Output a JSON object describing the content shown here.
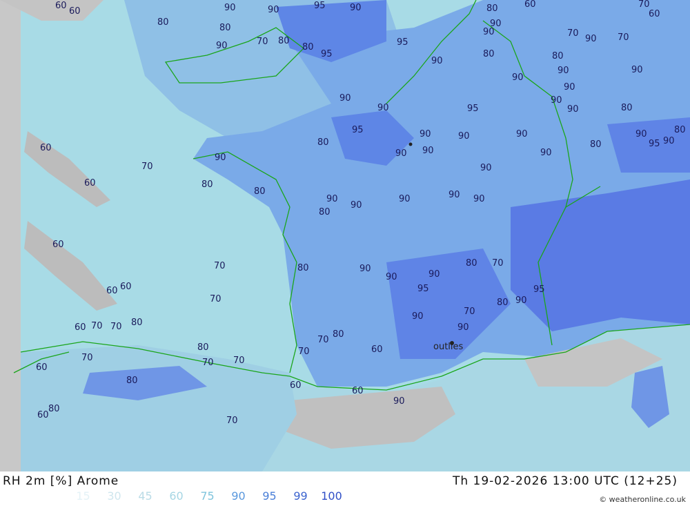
{
  "map": {
    "colors": {
      "land_low": "#9fd3e0",
      "land_mid": "#8fbfe6",
      "land_high": "#6f9ee8",
      "land_max": "#5a7fe6",
      "sea": "#c8c8c8",
      "border": "#1aa51a",
      "contour": "#555577"
    },
    "city_labels": [
      "outlies"
    ],
    "contour_labels": [
      {
        "t": "60"
      },
      {
        "t": "60"
      },
      {
        "t": "90"
      },
      {
        "t": "90"
      },
      {
        "t": "95"
      },
      {
        "t": "90"
      },
      {
        "t": "80"
      },
      {
        "t": "60"
      },
      {
        "t": "70"
      },
      {
        "t": "60"
      },
      {
        "t": "80"
      },
      {
        "t": "80"
      },
      {
        "t": "90"
      },
      {
        "t": "70"
      },
      {
        "t": "80"
      },
      {
        "t": "80"
      },
      {
        "t": "95"
      },
      {
        "t": "95"
      },
      {
        "t": "90"
      },
      {
        "t": "90"
      },
      {
        "t": "90"
      },
      {
        "t": "70"
      },
      {
        "t": "90"
      },
      {
        "t": "70"
      },
      {
        "t": "80"
      },
      {
        "t": "80"
      },
      {
        "t": "90"
      },
      {
        "t": "90"
      },
      {
        "t": "90"
      },
      {
        "t": "90"
      },
      {
        "t": "90"
      },
      {
        "t": "90"
      },
      {
        "t": "95"
      },
      {
        "t": "95"
      },
      {
        "t": "90"
      },
      {
        "t": "90"
      },
      {
        "t": "80"
      },
      {
        "t": "90"
      },
      {
        "t": "95"
      },
      {
        "t": "90"
      },
      {
        "t": "90"
      },
      {
        "t": "90"
      },
      {
        "t": "90"
      },
      {
        "t": "80"
      },
      {
        "t": "90"
      },
      {
        "t": "90"
      },
      {
        "t": "60"
      },
      {
        "t": "70"
      },
      {
        "t": "90"
      },
      {
        "t": "60"
      },
      {
        "t": "80"
      },
      {
        "t": "80"
      },
      {
        "t": "90"
      },
      {
        "t": "90"
      },
      {
        "t": "80"
      },
      {
        "t": "90"
      },
      {
        "t": "90"
      },
      {
        "t": "90"
      },
      {
        "t": "80"
      },
      {
        "t": "80"
      },
      {
        "t": "90"
      },
      {
        "t": "90"
      },
      {
        "t": "60"
      },
      {
        "t": "70"
      },
      {
        "t": "70"
      },
      {
        "t": "80"
      },
      {
        "t": "60"
      },
      {
        "t": "60"
      },
      {
        "t": "70"
      },
      {
        "t": "80"
      },
      {
        "t": "90"
      },
      {
        "t": "90"
      },
      {
        "t": "95"
      },
      {
        "t": "90"
      },
      {
        "t": "90"
      },
      {
        "t": "80"
      },
      {
        "t": "70"
      },
      {
        "t": "80"
      },
      {
        "t": "70"
      },
      {
        "t": "90"
      },
      {
        "t": "95"
      },
      {
        "t": "90"
      },
      {
        "t": "60"
      },
      {
        "t": "70"
      },
      {
        "t": "80"
      },
      {
        "t": "60"
      },
      {
        "t": "70"
      },
      {
        "t": "80"
      },
      {
        "t": "70"
      },
      {
        "t": "60"
      },
      {
        "t": "70"
      },
      {
        "t": "60"
      },
      {
        "t": "80"
      },
      {
        "t": "70"
      },
      {
        "t": "70"
      },
      {
        "t": "60"
      },
      {
        "t": "60"
      },
      {
        "t": "70"
      },
      {
        "t": "80"
      },
      {
        "t": "90"
      }
    ]
  },
  "footer": {
    "legend_title": "RH 2m [%] Arome",
    "valid_time": "Th 19-02-2026 13:00 UTC (12+25)",
    "legend": [
      {
        "label": "15",
        "color": "#e4f2f7"
      },
      {
        "label": "30",
        "color": "#cfe6ee"
      },
      {
        "label": "45",
        "color": "#b9dbe6"
      },
      {
        "label": "60",
        "color": "#a6d6e4"
      },
      {
        "label": "75",
        "color": "#7fc4dc"
      },
      {
        "label": "90",
        "color": "#5a98dd"
      },
      {
        "label": "95",
        "color": "#4a7fd8"
      },
      {
        "label": "99",
        "color": "#3b63cf"
      },
      {
        "label": "100",
        "color": "#2f4ec6"
      }
    ],
    "credit": "© weatheronline.co.uk"
  }
}
